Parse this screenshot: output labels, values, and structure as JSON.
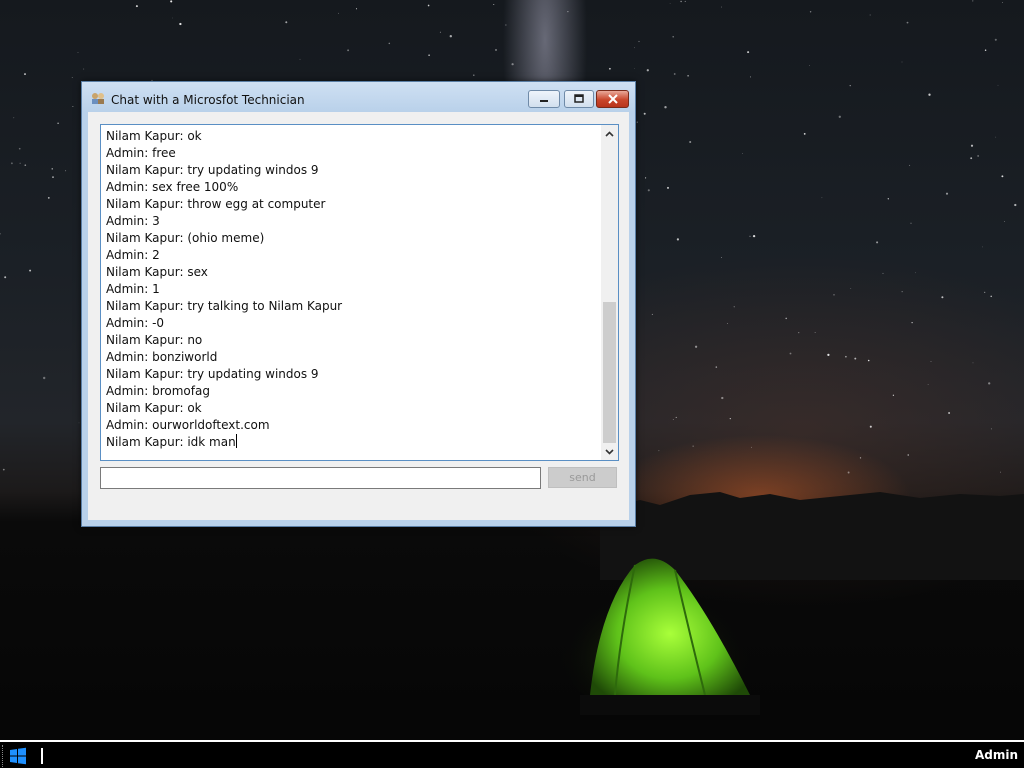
{
  "window": {
    "title": "Chat with a Microsfot Technician",
    "close_color": "#c9462c"
  },
  "chat": {
    "messages": [
      "Nilam Kapur: ok",
      "Admin: free",
      "Nilam Kapur: try updating windos 9",
      "Admin: sex free 100%",
      "Nilam Kapur: throw egg at computer",
      "Admin: 3",
      "Nilam Kapur: (ohio meme)",
      "Admin: 2",
      "Nilam Kapur: sex",
      "Admin: 1",
      "Nilam Kapur: try talking to Nilam Kapur",
      "Admin: -0",
      "Nilam Kapur: no",
      "Admin: bonziworld",
      "Nilam Kapur: try updating windos 9",
      "Admin: bromofag",
      "Nilam Kapur: ok",
      "Admin: ourworldoftext.com",
      "Nilam Kapur: idk man"
    ],
    "scroll_position": 1.0
  },
  "input": {
    "value": "",
    "placeholder": ""
  },
  "send_button": {
    "label": "send",
    "enabled": false
  },
  "taskbar": {
    "user": "Admin"
  },
  "icons": {
    "window": "chat-app-icon",
    "start": "windows-logo-icon"
  }
}
